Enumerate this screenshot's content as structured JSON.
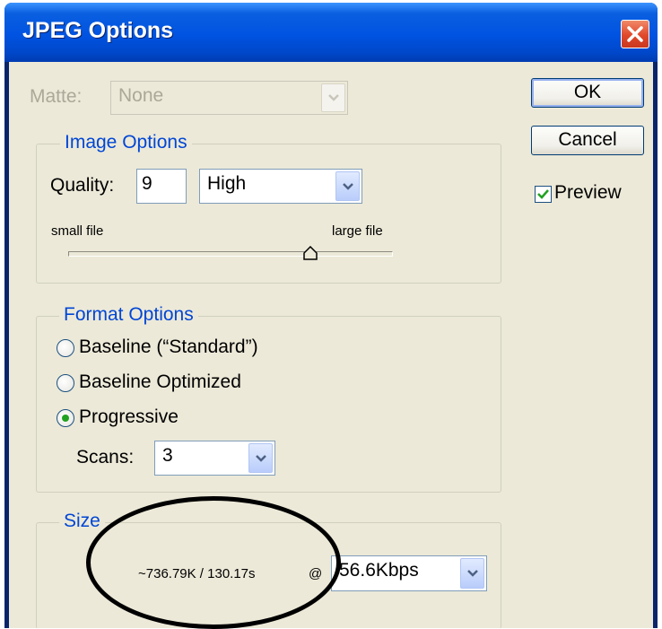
{
  "window": {
    "title": "JPEG Options"
  },
  "matte": {
    "label": "Matte:",
    "value": "None"
  },
  "buttons": {
    "ok": "OK",
    "cancel": "Cancel"
  },
  "preview": {
    "label": "Preview",
    "checked": true
  },
  "image_options": {
    "legend": "Image Options",
    "quality_label": "Quality:",
    "quality_value": "9",
    "quality_preset": "High",
    "slider_min_label": "small file",
    "slider_max_label": "large file",
    "slider_level_fraction": 0.75
  },
  "format_options": {
    "legend": "Format Options",
    "options": [
      "Baseline (“Standard”)",
      "Baseline Optimized",
      "Progressive"
    ],
    "selected": "Progressive",
    "scans_label": "Scans:",
    "scans_value": "3"
  },
  "size": {
    "legend": "Size",
    "estimate": "~736.79K / 130.17s",
    "at": "@",
    "speed": "56.6Kbps"
  },
  "colors": {
    "title_bar": "#0053e1",
    "dialog_bg": "#ece9d8",
    "legend_text": "#0046d5",
    "close_button": "#e0482a"
  },
  "icons": {
    "close": "close-icon",
    "dropdown": "chevron-down-icon",
    "check": "check-icon"
  }
}
